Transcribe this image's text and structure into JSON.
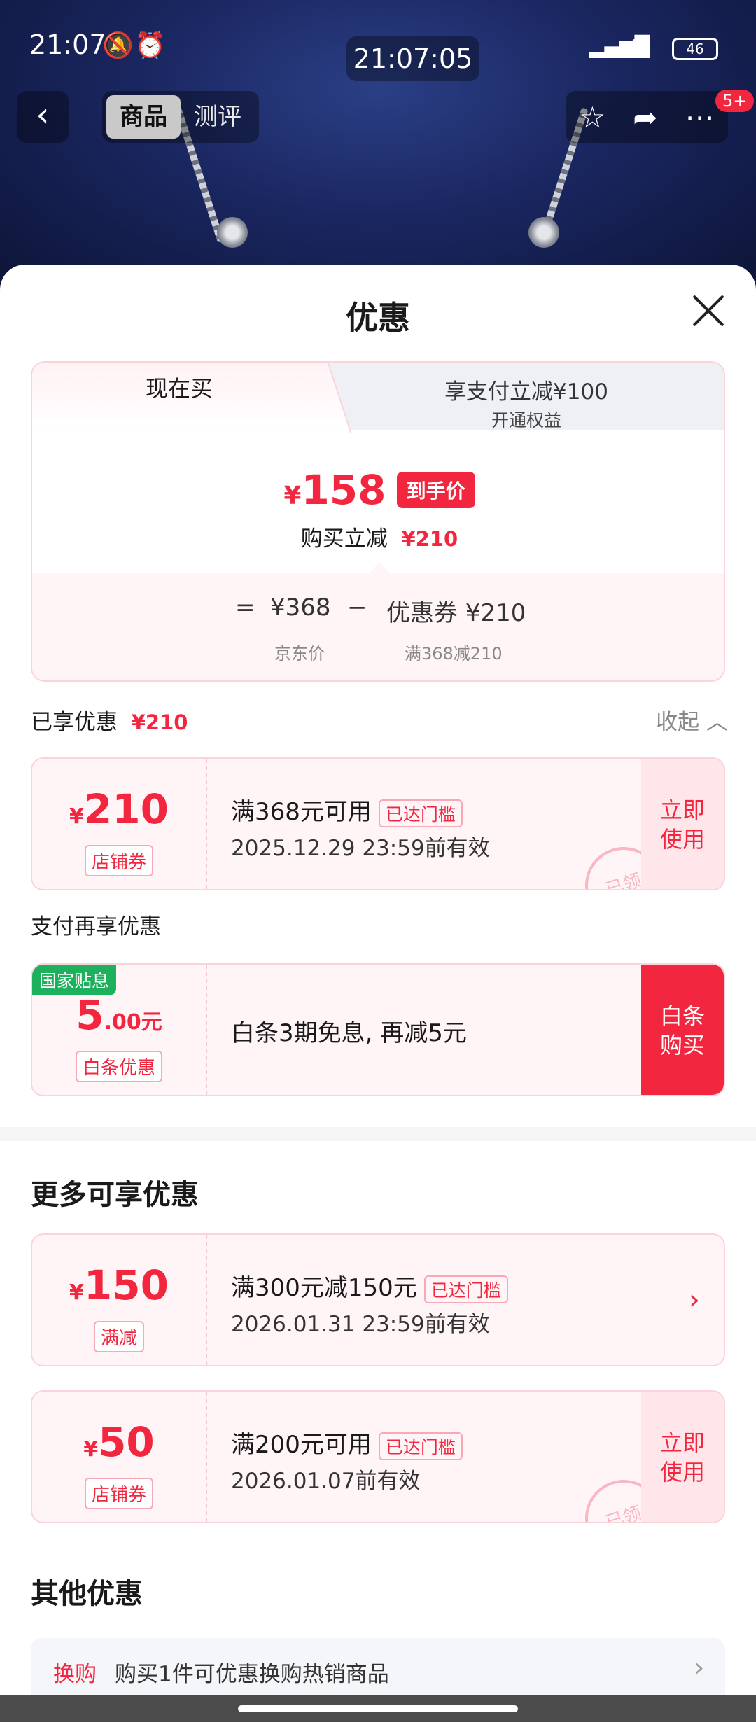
{
  "status_bar": {
    "time": "21:07",
    "center_clock": "21:07:05",
    "battery": "46",
    "icons": [
      "bell-off-icon",
      "alarm-icon",
      "signal-icon",
      "wifi-icon",
      "battery-icon"
    ]
  },
  "nav": {
    "tabs": [
      "商品",
      "测评"
    ],
    "active_tab": "商品",
    "badge": "5+"
  },
  "sheet": {
    "title": "优惠",
    "tab_now": "现在买",
    "tab_pay_title": "享支付立减¥100",
    "tab_pay_sub": "开通权益",
    "final_price": "158",
    "final_price_symbol": "¥",
    "final_price_tag": "到手价",
    "instant_off_label": "购买立减",
    "instant_off_value": "¥210",
    "formula": {
      "equals": "=",
      "base_price": "¥368",
      "minus": "−",
      "coupon": "优惠券 ¥210",
      "base_label": "京东价",
      "coupon_label": "满368减210"
    },
    "enjoyed_label": "已享优惠",
    "enjoyed_value": "¥210",
    "collapse": "收起"
  },
  "coupons_applied": [
    {
      "symbol": "¥",
      "amount": "210",
      "type": "店铺券",
      "line1": "满368元可用",
      "badge": "已达门槛",
      "line2": "2025.12.29 23:59前有效",
      "action": "立即\n使用",
      "stamp": "已领"
    }
  ],
  "pay_section": {
    "title": "支付再享优惠",
    "tag": "国家贴息",
    "amount_int": "5",
    "amount_dec": ".00元",
    "type": "白条优惠",
    "desc": "白条3期免息, 再减5元",
    "action": "白条\n购买"
  },
  "more_section": {
    "title": "更多可享优惠",
    "items": [
      {
        "symbol": "¥",
        "amount": "150",
        "type": "满减",
        "line1": "满300元减150元",
        "badge": "已达门槛",
        "line2": "2026.01.31 23:59前有效"
      },
      {
        "symbol": "¥",
        "amount": "50",
        "type": "店铺券",
        "line1": "满200元可用",
        "badge": "已达门槛",
        "line2": "2026.01.07前有效",
        "action": "立即\n使用",
        "stamp": "已领"
      }
    ]
  },
  "other_section": {
    "title": "其他优惠",
    "swap_key": "换购",
    "swap_text": "购买1件可优惠换购热销商品"
  },
  "colors": {
    "accent": "#f2273f",
    "green_tag": "#1db15e",
    "pink_bg": "#fff5f7"
  }
}
